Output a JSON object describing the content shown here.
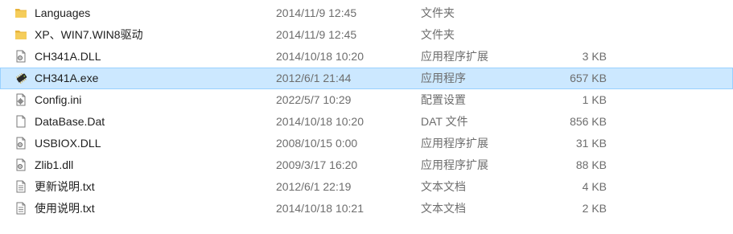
{
  "files": [
    {
      "name": "Languages",
      "date": "2014/11/9 12:45",
      "type": "文件夹",
      "size": "",
      "icon": "folder-icon",
      "selected": false
    },
    {
      "name": "XP、WIN7.WIN8驱动",
      "date": "2014/11/9 12:45",
      "type": "文件夹",
      "size": "",
      "icon": "folder-icon",
      "selected": false
    },
    {
      "name": "CH341A.DLL",
      "date": "2014/10/18 10:20",
      "type": "应用程序扩展",
      "size": "3 KB",
      "icon": "dll-file-icon",
      "selected": false
    },
    {
      "name": "CH341A.exe",
      "date": "2012/6/1 21:44",
      "type": "应用程序",
      "size": "657 KB",
      "icon": "exe-chip-icon",
      "selected": true
    },
    {
      "name": "Config.ini",
      "date": "2022/5/7 10:29",
      "type": "配置设置",
      "size": "1 KB",
      "icon": "ini-settings-icon",
      "selected": false
    },
    {
      "name": "DataBase.Dat",
      "date": "2014/10/18 10:20",
      "type": "DAT 文件",
      "size": "856 KB",
      "icon": "blank-file-icon",
      "selected": false
    },
    {
      "name": "USBIOX.DLL",
      "date": "2008/10/15 0:00",
      "type": "应用程序扩展",
      "size": "31 KB",
      "icon": "dll-file-icon",
      "selected": false
    },
    {
      "name": "Zlib1.dll",
      "date": "2009/3/17 16:20",
      "type": "应用程序扩展",
      "size": "88 KB",
      "icon": "dll-file-icon",
      "selected": false
    },
    {
      "name": "更新说明.txt",
      "date": "2012/6/1 22:19",
      "type": "文本文档",
      "size": "4 KB",
      "icon": "text-file-icon",
      "selected": false
    },
    {
      "name": "使用说明.txt",
      "date": "2014/10/18 10:21",
      "type": "文本文档",
      "size": "2 KB",
      "icon": "text-file-icon",
      "selected": false
    }
  ],
  "colors": {
    "selection_background": "#cce8ff",
    "selection_border": "#99d1ff",
    "folder_yellow": "#f2c24a",
    "secondary_text": "#6d6d6d"
  }
}
